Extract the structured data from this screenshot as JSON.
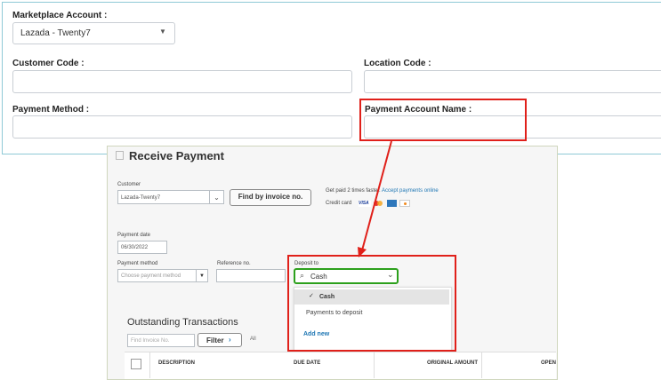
{
  "marketplace": {
    "label": "Marketplace Account :",
    "selected": "Lazada - Twenty7"
  },
  "customer_code": {
    "label": "Customer Code :",
    "value": ""
  },
  "location_code": {
    "label": "Location Code :",
    "value": ""
  },
  "payment_method": {
    "label": "Payment Method :",
    "value": ""
  },
  "payment_account_name": {
    "label": "Payment Account Name :",
    "value": ""
  },
  "receive_payment": {
    "title": "Receive Payment",
    "customer_label": "Customer",
    "customer_value": "Lazada-Twenty7",
    "find_button": "Find by invoice no.",
    "paid_text": "Get paid 2 times faster.",
    "accept_link": "Accept payments online",
    "credit_card_label": "Credit card",
    "payment_date_label": "Payment date",
    "payment_date_value": "06/30/2022",
    "payment_method_label": "Payment method",
    "payment_method_placeholder": "Choose payment method",
    "reference_label": "Reference no.",
    "deposit_to_label": "Deposit to",
    "deposit_to_value": "Cash",
    "dropdown": {
      "items": [
        "Cash",
        "Payments to deposit"
      ],
      "add_new": "Add new"
    },
    "outstanding_title": "Outstanding Transactions",
    "find_invoice_placeholder": "Find Invoice No.",
    "filter_button": "Filter",
    "all_label": "All",
    "columns": [
      "DESCRIPTION",
      "DUE DATE",
      "ORIGINAL AMOUNT",
      "OPEN"
    ]
  },
  "colors": {
    "accent_red": "#e0201a",
    "accent_green": "#2ca01c",
    "link_blue": "#1f77b4"
  }
}
